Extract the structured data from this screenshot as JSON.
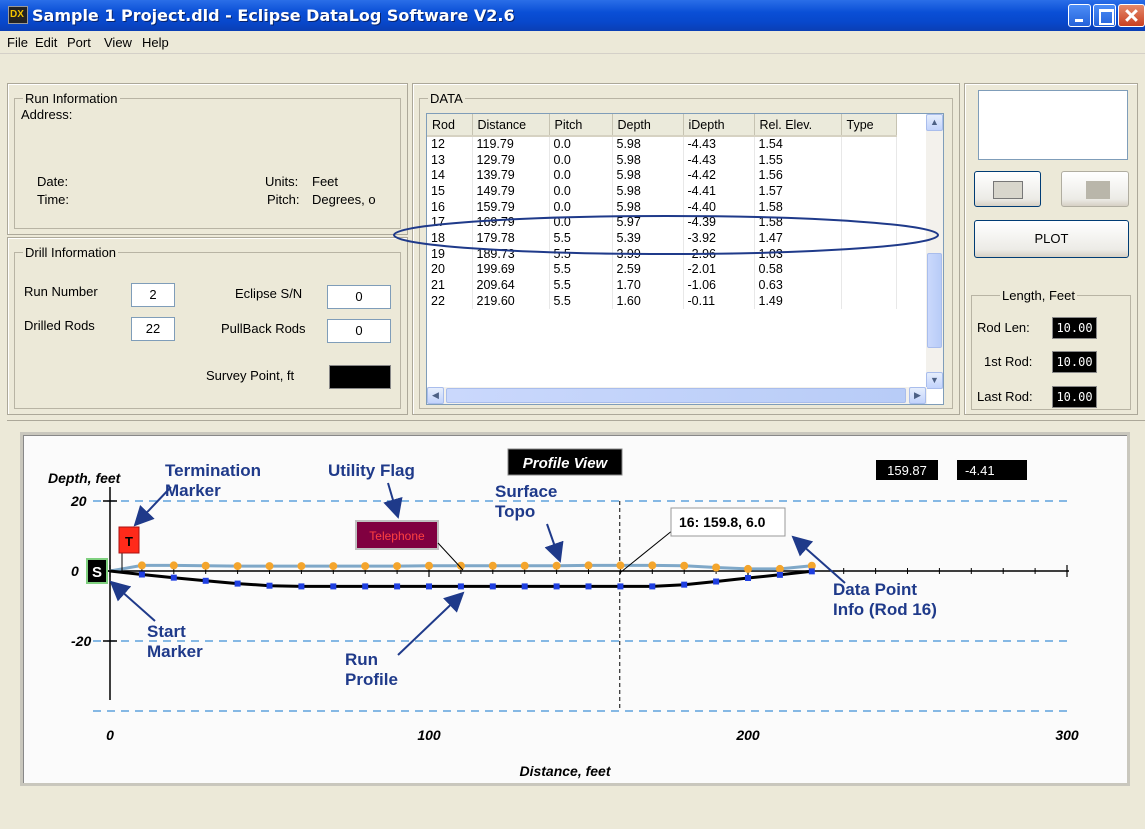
{
  "window": {
    "title": "Sample 1 Project.dld - Eclipse DataLog Software V2.6"
  },
  "menu": [
    "File",
    "Edit",
    "Port",
    "View",
    "Help"
  ],
  "run_info": {
    "title": "Run Information",
    "address_label": "Address:",
    "date_label": "Date:",
    "time_label": "Time:",
    "units_label": "Units:",
    "units_value": "Feet",
    "pitch_label": "Pitch:",
    "pitch_value": "Degrees, o"
  },
  "drill_info": {
    "title": "Drill Information",
    "run_number_label": "Run Number",
    "run_number": "2",
    "eclipse_sn_label": "Eclipse S/N",
    "eclipse_sn": "0",
    "drilled_rods_label": "Drilled Rods",
    "drilled_rods": "22",
    "pullback_rods_label": "PullBack Rods",
    "pullback_rods": "0",
    "survey_point_label": "Survey Point, ft",
    "survey_point": ""
  },
  "data_grid": {
    "title": "DATA",
    "columns": [
      "Rod",
      "Distance",
      "Pitch",
      "Depth",
      "iDepth",
      "Rel. Elev.",
      "Type"
    ],
    "rows": [
      [
        "12",
        "119.79",
        "0.0",
        "5.98",
        "-4.43",
        "1.54",
        ""
      ],
      [
        "13",
        "129.79",
        "0.0",
        "5.98",
        "-4.43",
        "1.55",
        ""
      ],
      [
        "14",
        "139.79",
        "0.0",
        "5.98",
        "-4.42",
        "1.56",
        ""
      ],
      [
        "15",
        "149.79",
        "0.0",
        "5.98",
        "-4.41",
        "1.57",
        ""
      ],
      [
        "16",
        "159.79",
        "0.0",
        "5.98",
        "-4.40",
        "1.58",
        ""
      ],
      [
        "17",
        "169.79",
        "0.0",
        "5.97",
        "-4.39",
        "1.58",
        ""
      ],
      [
        "18",
        "179.78",
        "5.5",
        "5.39",
        "-3.92",
        "1.47",
        ""
      ],
      [
        "19",
        "189.73",
        "5.5",
        "3.99",
        "-2.96",
        "1.03",
        ""
      ],
      [
        "20",
        "199.69",
        "5.5",
        "2.59",
        "-2.01",
        "0.58",
        ""
      ],
      [
        "21",
        "209.64",
        "5.5",
        "1.70",
        "-1.06",
        "0.63",
        ""
      ],
      [
        "22",
        "219.60",
        "5.5",
        "1.60",
        "-0.11",
        "1.49",
        ""
      ]
    ]
  },
  "right_panel": {
    "plot_button": "PLOT",
    "length_title": "Length, Feet",
    "rod_len_label": "Rod Len:",
    "rod_len": "10.00",
    "first_rod_label": "1st Rod:",
    "first_rod": "10.00",
    "last_rod_label": "Last Rod:",
    "last_rod": "10.00"
  },
  "plot": {
    "title": "Profile View",
    "ylabel": "Depth, feet",
    "xlabel": "Distance, feet",
    "readout_x": "159.87",
    "readout_y": "-4.41",
    "point_info": "16: 159.8, 6.0",
    "start_marker": "S",
    "termination_marker": "T",
    "utility_flag_label": "Telephone"
  },
  "annotations": {
    "termination_marker": "Termination\nMarker",
    "utility_flag": "Utility Flag",
    "surface_topo": "Surface\nTopo",
    "start_marker": "Start\nMarker",
    "run_profile": "Run\nProfile",
    "data_point_info": "Data Point\nInfo (Rod 16)"
  },
  "chart_data": {
    "type": "line",
    "title": "Profile View",
    "xlabel": "Distance, feet",
    "ylabel": "Depth, feet",
    "xlim": [
      0,
      300
    ],
    "ylim": [
      -40,
      20
    ],
    "xticks": [
      0,
      100,
      200,
      300
    ],
    "yticks": [
      20,
      0,
      -20
    ],
    "grid": "dashed horizontal lines at 20, -20, -40",
    "series": [
      {
        "name": "Surface Topo",
        "color": "#f4a52c",
        "line_color": "#7fa8c8",
        "x": [
          10,
          20,
          30,
          40,
          50,
          60,
          70,
          80,
          90,
          100,
          110,
          120,
          130,
          140,
          150,
          160,
          170,
          180,
          190,
          200,
          210,
          220
        ],
        "y": [
          1.6,
          1.6,
          1.5,
          1.4,
          1.4,
          1.4,
          1.4,
          1.4,
          1.4,
          1.5,
          1.5,
          1.5,
          1.5,
          1.5,
          1.6,
          1.6,
          1.6,
          1.5,
          1.0,
          0.6,
          0.6,
          1.5
        ]
      },
      {
        "name": "Run Profile",
        "color": "#1f3fe0",
        "line_color": "#000000",
        "x": [
          10,
          20,
          30,
          40,
          50,
          60,
          70,
          80,
          90,
          100,
          110,
          120,
          130,
          140,
          150,
          160,
          170,
          180,
          190,
          200,
          210,
          220
        ],
        "y": [
          -1.0,
          -1.9,
          -2.8,
          -3.6,
          -4.2,
          -4.4,
          -4.4,
          -4.4,
          -4.4,
          -4.4,
          -4.4,
          -4.4,
          -4.4,
          -4.4,
          -4.4,
          -4.4,
          -4.4,
          -3.9,
          -3.0,
          -2.0,
          -1.1,
          -0.1
        ]
      }
    ],
    "selected_x": 159.8
  }
}
